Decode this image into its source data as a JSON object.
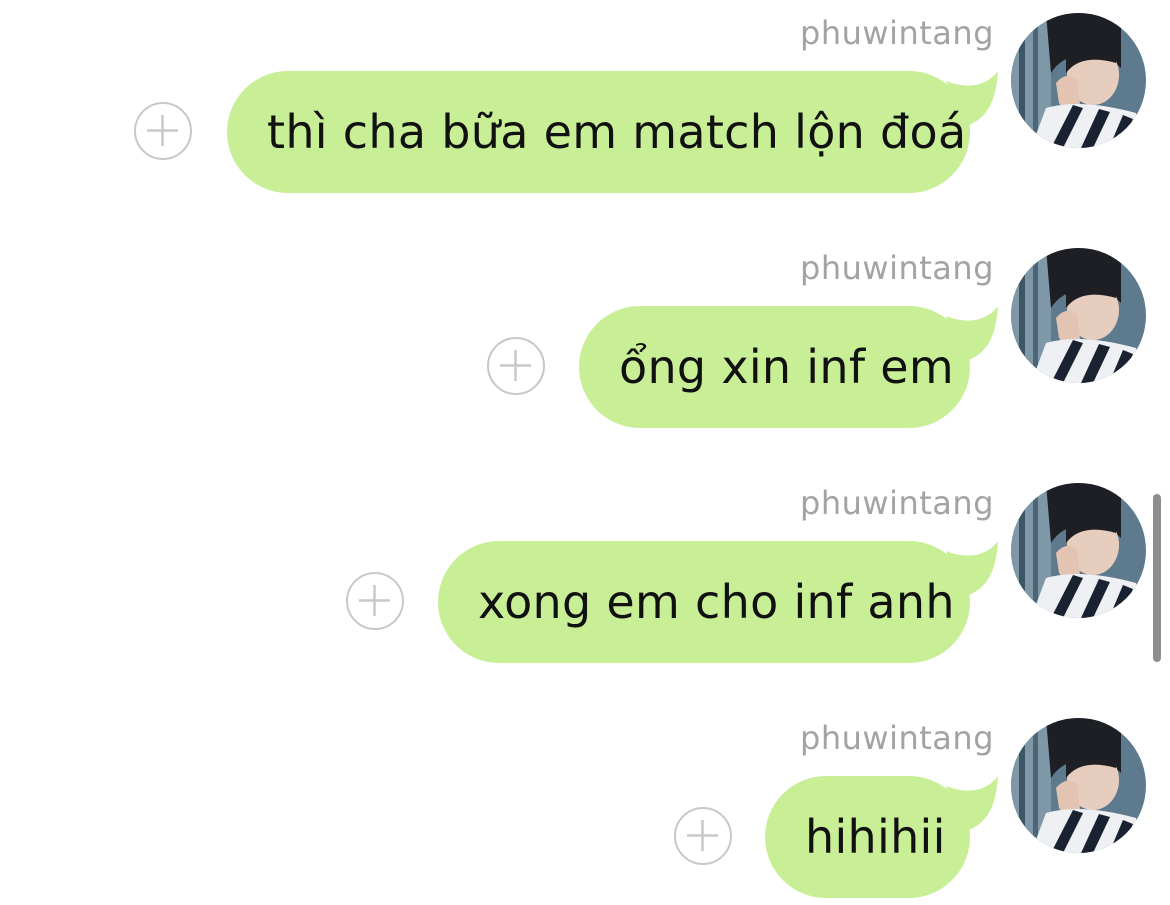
{
  "conversation": {
    "messages": [
      {
        "sender": "phuwintang",
        "text": "thì cha bữa em match lộn đoá"
      },
      {
        "sender": "phuwintang",
        "text": "ổng xin inf em"
      },
      {
        "sender": "phuwintang",
        "text": "xong em cho inf anh"
      },
      {
        "sender": "phuwintang",
        "text": "hihihii"
      }
    ]
  },
  "colors": {
    "bubble": "#c8ef96",
    "sender_name": "#a3a3a3",
    "add_button_border": "#c8c8c8",
    "scrollbar": "#8e8e8e"
  },
  "icons": {
    "add_button": "plus-circle-icon",
    "avatar": "user-photo-avatar"
  }
}
